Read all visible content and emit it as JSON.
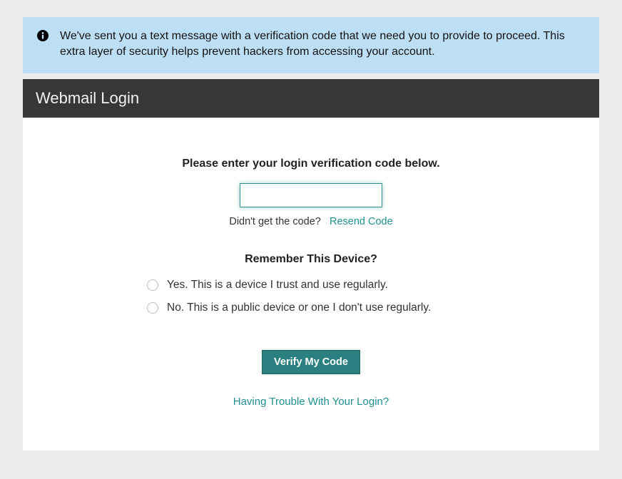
{
  "alert": {
    "message": "We've sent you a text message with a verification code that we need you to provide to proceed. This extra layer of security helps prevent hackers from accessing your account."
  },
  "header": {
    "title": "Webmail Login"
  },
  "verify": {
    "prompt": "Please enter your login verification code below.",
    "code_value": "",
    "didnt_get": "Didn't get the code?",
    "resend_label": "Resend Code"
  },
  "remember": {
    "heading": "Remember This Device?",
    "options": [
      {
        "label": "Yes. This is a device I trust and use regularly."
      },
      {
        "label": "No. This is a public device or one I don't use regularly."
      }
    ]
  },
  "actions": {
    "verify_label": "Verify My Code",
    "trouble_label": "Having Trouble With Your Login?"
  },
  "colors": {
    "alert_bg": "#bddff5",
    "header_bg": "#373737",
    "accent": "#2a8080",
    "link": "#1f8f8f",
    "page_bg": "#ececec"
  }
}
